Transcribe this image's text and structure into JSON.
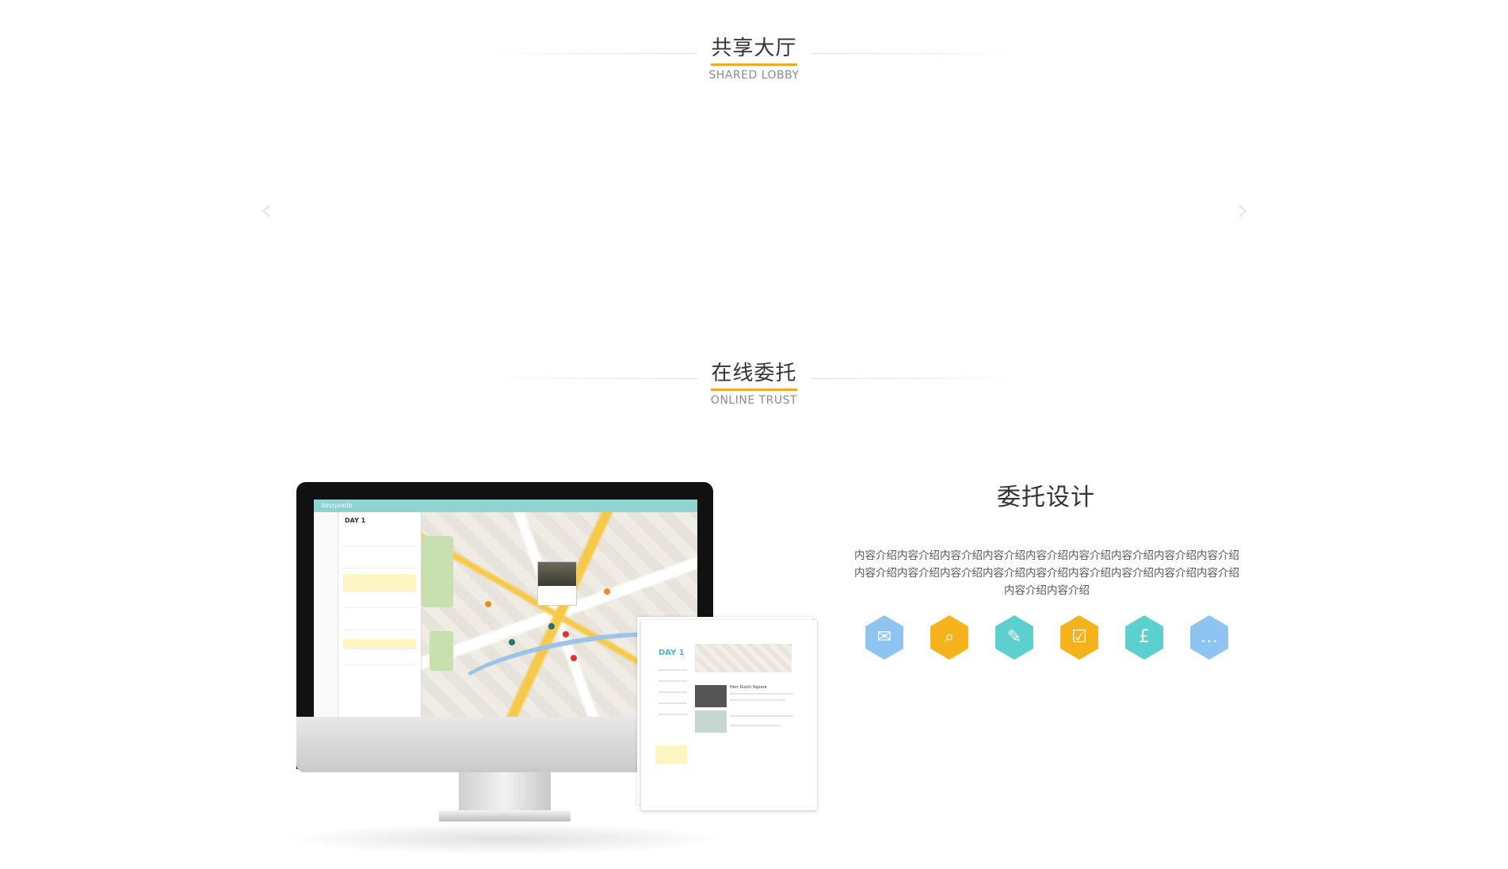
{
  "sections": {
    "shared": {
      "title": "共享大厅",
      "subtitle": "SHARED LOBBY"
    },
    "trust": {
      "title": "在线委托",
      "subtitle": "ONLINE TRUST"
    }
  },
  "carousel": {
    "prev_glyph": "‹",
    "next_glyph": "›"
  },
  "app_screen": {
    "logo": "tourplanb",
    "day_label": "DAY 1"
  },
  "sheet": {
    "day_label": "DAY 1",
    "place_title": "Herr Dutch Square"
  },
  "feature": {
    "title": "委托设计",
    "description": "内容介绍内容介绍内容介绍内容介绍内容介绍内容介绍内容介绍内容介绍内容介绍内容介绍内容介绍内容介绍内容介绍内容介绍内容介绍内容介绍内容介绍内容介绍内容介绍内容介绍"
  },
  "icons": [
    {
      "name": "mail-icon",
      "color": "#8ec5f0",
      "glyph": "✉"
    },
    {
      "name": "search-doc-icon",
      "color": "#f5b21a",
      "glyph": "⌕"
    },
    {
      "name": "edit-icon",
      "color": "#5ccfcf",
      "glyph": "✎"
    },
    {
      "name": "checklist-icon",
      "color": "#f5b21a",
      "glyph": "☑"
    },
    {
      "name": "money-bag-icon",
      "color": "#5ccfcf",
      "glyph": "£"
    },
    {
      "name": "chat-icon",
      "color": "#8ec5f0",
      "glyph": "…"
    }
  ]
}
